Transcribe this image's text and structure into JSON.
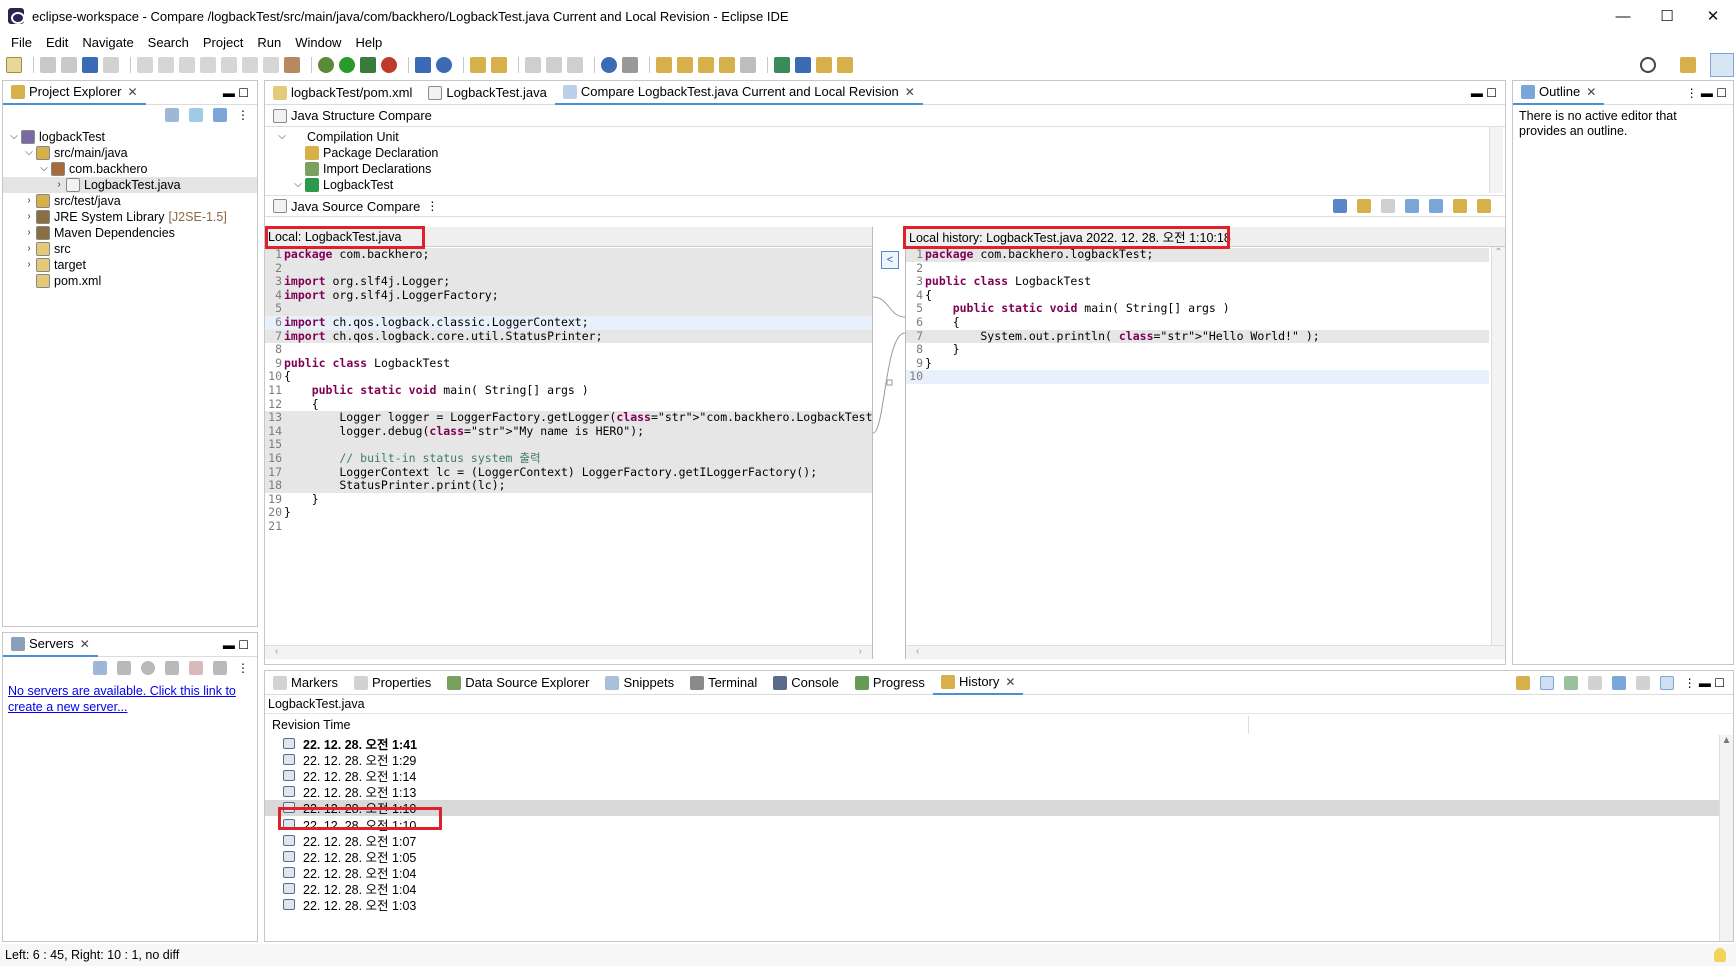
{
  "window": {
    "title": "eclipse-workspace - Compare /logbackTest/src/main/java/com/backhero/LogbackTest.java Current and Local Revision - Eclipse IDE",
    "minimize": "—",
    "maximize": "☐",
    "close": "✕"
  },
  "menu": [
    "File",
    "Edit",
    "Navigate",
    "Search",
    "Project",
    "Run",
    "Window",
    "Help"
  ],
  "project_explorer": {
    "tab": "Project Explorer",
    "tree": [
      {
        "label": "logbackTest",
        "depth": 0,
        "twisty": "⌵",
        "icon": "project-icon"
      },
      {
        "label": "src/main/java",
        "depth": 1,
        "twisty": "⌵",
        "icon": "source-folder-icon"
      },
      {
        "label": "com.backhero",
        "depth": 2,
        "twisty": "⌵",
        "icon": "package-icon"
      },
      {
        "label": "LogbackTest.java",
        "depth": 3,
        "twisty": "›",
        "icon": "java-file-icon"
      },
      {
        "label": "src/test/java",
        "depth": 1,
        "twisty": "›",
        "icon": "source-folder-icon"
      },
      {
        "label": "JRE System Library",
        "depth": 1,
        "twisty": "›",
        "icon": "library-icon",
        "suffix": "[J2SE-1.5]"
      },
      {
        "label": "Maven Dependencies",
        "depth": 1,
        "twisty": "›",
        "icon": "library-icon"
      },
      {
        "label": "src",
        "depth": 1,
        "twisty": "›",
        "icon": "folder-icon"
      },
      {
        "label": "target",
        "depth": 1,
        "twisty": "›",
        "icon": "folder-icon"
      },
      {
        "label": "pom.xml",
        "depth": 1,
        "twisty": "",
        "icon": "xml-file-icon"
      }
    ]
  },
  "servers": {
    "tab": "Servers",
    "link_line1": "No servers are available. Click this link to",
    "link_line2": "create a new server..."
  },
  "editor_tabs": [
    {
      "label": "logbackTest/pom.xml"
    },
    {
      "label": "LogbackTest.java"
    },
    {
      "label": "Compare LogbackTest.java Current and Local Revision"
    }
  ],
  "structure_compare": {
    "title": "Java Structure Compare",
    "items": [
      {
        "label": "Compilation Unit",
        "depth": 0,
        "twisty": "⌵"
      },
      {
        "label": "Package Declaration",
        "depth": 1,
        "twisty": ""
      },
      {
        "label": "Import Declarations",
        "depth": 1,
        "twisty": ""
      },
      {
        "label": "LogbackTest",
        "depth": 1,
        "twisty": "⌵"
      }
    ]
  },
  "source_compare": {
    "title": "Java Source Compare",
    "left_header": "Local: LogbackTest.java",
    "right_header": "Local history: LogbackTest.java 2022. 12. 28. 오전 1:10:18",
    "copy_button": "<",
    "left_code": [
      {
        "n": "1",
        "text": "package com.backhero;",
        "bg": "gray"
      },
      {
        "n": "2",
        "text": "",
        "bg": "gray"
      },
      {
        "n": "3",
        "text": "import org.slf4j.Logger;",
        "bg": "gray"
      },
      {
        "n": "4",
        "text": "import org.slf4j.LoggerFactory;",
        "bg": "gray"
      },
      {
        "n": "5",
        "text": "",
        "bg": "gray"
      },
      {
        "n": "6",
        "text": "import ch.qos.logback.classic.LoggerContext;",
        "bg": "blue"
      },
      {
        "n": "7",
        "text": "import ch.qos.logback.core.util.StatusPrinter;",
        "bg": "gray"
      },
      {
        "n": "8",
        "text": "",
        "bg": ""
      },
      {
        "n": "9",
        "text": "public class LogbackTest",
        "bg": ""
      },
      {
        "n": "10",
        "text": "{",
        "bg": ""
      },
      {
        "n": "11",
        "text": "    public static void main( String[] args )",
        "bg": ""
      },
      {
        "n": "12",
        "text": "    {",
        "bg": ""
      },
      {
        "n": "13",
        "text": "        Logger logger = LoggerFactory.getLogger(\"com.backhero.LogbackTest\");",
        "bg": "gray"
      },
      {
        "n": "14",
        "text": "        logger.debug(\"My name is HERO\");",
        "bg": "gray"
      },
      {
        "n": "15",
        "text": "",
        "bg": "gray"
      },
      {
        "n": "16",
        "text": "        // built-in status system 출력",
        "bg": "gray"
      },
      {
        "n": "17",
        "text": "        LoggerContext lc = (LoggerContext) LoggerFactory.getILoggerFactory();",
        "bg": "gray"
      },
      {
        "n": "18",
        "text": "        StatusPrinter.print(lc);",
        "bg": "gray"
      },
      {
        "n": "19",
        "text": "    }",
        "bg": ""
      },
      {
        "n": "20",
        "text": "}",
        "bg": ""
      },
      {
        "n": "21",
        "text": "",
        "bg": ""
      }
    ],
    "right_code": [
      {
        "n": "1",
        "text": "package com.backhero.logbackTest;",
        "bg": "gray"
      },
      {
        "n": "2",
        "text": "",
        "bg": ""
      },
      {
        "n": "3",
        "text": "public class LogbackTest",
        "bg": ""
      },
      {
        "n": "4",
        "text": "{",
        "bg": ""
      },
      {
        "n": "5",
        "text": "    public static void main( String[] args )",
        "bg": ""
      },
      {
        "n": "6",
        "text": "    {",
        "bg": ""
      },
      {
        "n": "7",
        "text": "        System.out.println( \"Hello World!\" );",
        "bg": "gray"
      },
      {
        "n": "8",
        "text": "    }",
        "bg": ""
      },
      {
        "n": "9",
        "text": "}",
        "bg": ""
      },
      {
        "n": "10",
        "text": "",
        "bg": "blue"
      }
    ]
  },
  "outline": {
    "tab": "Outline",
    "message": "There is no active editor that provides an outline."
  },
  "bottom_tabs": [
    "Markers",
    "Properties",
    "Data Source Explorer",
    "Snippets",
    "Terminal",
    "Console",
    "Progress",
    "History"
  ],
  "history": {
    "file": "LogbackTest.java",
    "column": "Revision Time",
    "rows": [
      {
        "time": "22. 12. 28. 오전 1:41",
        "bold": true
      },
      {
        "time": "22. 12. 28. 오전 1:29"
      },
      {
        "time": "22. 12. 28. 오전 1:14"
      },
      {
        "time": "22. 12. 28. 오전 1:13"
      },
      {
        "time": "22. 12. 28. 오전 1:10",
        "selected": true
      },
      {
        "time": "22. 12. 28. 오전 1:10"
      },
      {
        "time": "22. 12. 28. 오전 1:07"
      },
      {
        "time": "22. 12. 28. 오전 1:05"
      },
      {
        "time": "22. 12. 28. 오전 1:04"
      },
      {
        "time": "22. 12. 28. 오전 1:04"
      },
      {
        "time": "22. 12. 28. 오전 1:03"
      }
    ]
  },
  "status": "Left: 6 : 45, Right: 10 : 1, no diff",
  "colors": {
    "highlight": "#e0202a",
    "selection": "#d9d9d9",
    "link": "#0000ee"
  }
}
